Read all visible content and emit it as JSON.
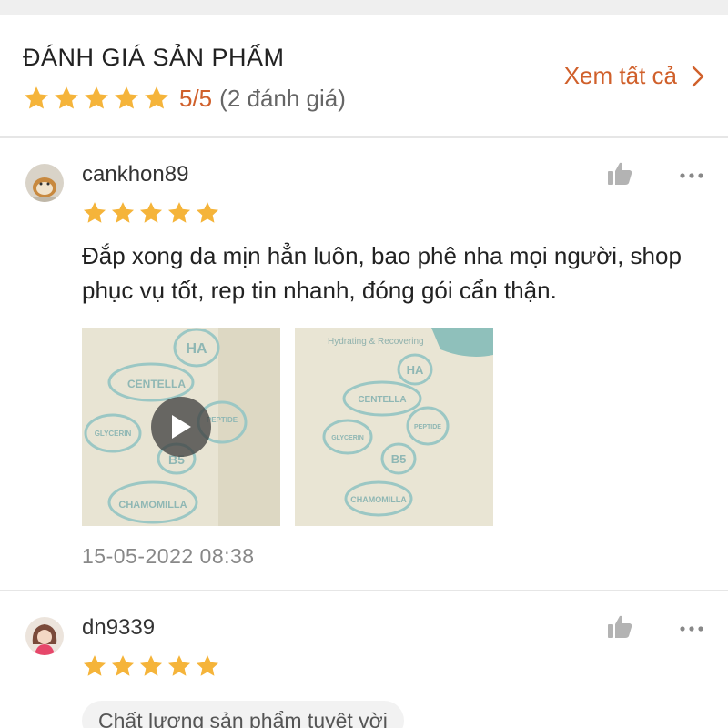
{
  "header": {
    "title": "ĐÁNH GIÁ SẢN PHẨM",
    "rating_value": "5/5",
    "rating_count": "(2 đánh giá)",
    "view_all": "Xem tất cả",
    "stars": 5
  },
  "colors": {
    "accent": "#d0602b",
    "star": "#f5b43a",
    "divider": "#e6e6e6"
  },
  "reviews": [
    {
      "username": "cankhon89",
      "stars": 5,
      "comment": "Đắp xong da mịn hẳn luôn, bao phê nha mọi người, shop phục vụ tốt, rep tin nhanh, đóng gói cẩn thận.",
      "media": [
        {
          "type": "video",
          "labels": [
            "HA",
            "CENTELLA",
            "PEPTIDE",
            "GLYCERIN",
            "B5",
            "CHAMOMILLA"
          ]
        },
        {
          "type": "image",
          "caption": "Hydrating & Recovering",
          "labels": [
            "HA",
            "CENTELLA",
            "PEPTIDE",
            "GLYCERIN",
            "B5",
            "CHAMOMILLA"
          ]
        }
      ],
      "timestamp": "15-05-2022 08:38"
    },
    {
      "username": "dn9339",
      "stars": 5,
      "tag": "Chất lượng sản phẩm tuyệt vời"
    }
  ],
  "icons": {
    "like": "thumbs-up-icon",
    "more": "more-dots-icon",
    "play": "play-icon",
    "chevron": "chevron-right-icon"
  }
}
